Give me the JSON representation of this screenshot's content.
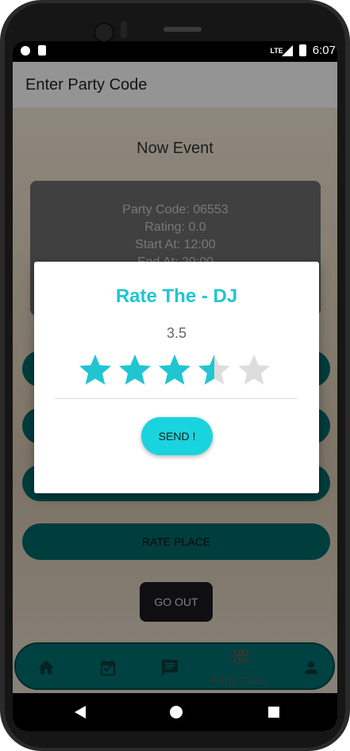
{
  "status_bar": {
    "time": "6:07",
    "network": "LTE"
  },
  "app_bar": {
    "title": "Enter Party Code"
  },
  "event": {
    "heading": "Now Event",
    "party_code_line": "Party Code: 06553",
    "rating_line": "Rating: 0.0",
    "start_line": "Start At: 12:00",
    "end_line": "End At: 20:00"
  },
  "buttons": {
    "rate_place": "RATE PLACE",
    "go_out": "GO OUT"
  },
  "bottom_nav": {
    "items": [
      {
        "icon": "home-icon"
      },
      {
        "icon": "calendar-icon"
      },
      {
        "icon": "chat-icon"
      },
      {
        "icon": "qr-code-icon",
        "label": "Party Code"
      },
      {
        "icon": "person-icon"
      }
    ]
  },
  "dialog": {
    "title": "Rate The - DJ",
    "rating_value": "3.5",
    "rating": 3.5,
    "rating_max": 5,
    "send_label": "SEND !"
  },
  "colors": {
    "accent": "#1FC6D1",
    "teal_button": "#006A6A",
    "star_filled": "#1FC6D1",
    "star_empty": "#DDDDDD"
  }
}
